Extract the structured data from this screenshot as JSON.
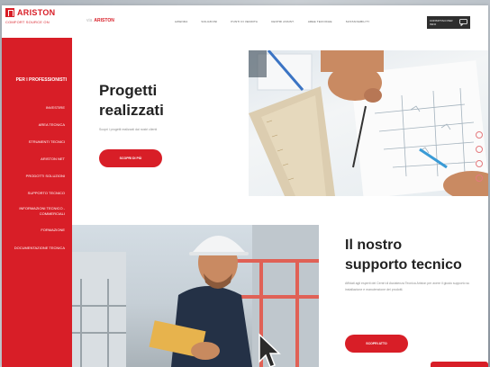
{
  "sidebar": {
    "brand_name": "ARISTON",
    "brand_tagline": "COMFORT SOURCE ON",
    "heading": "PER I PROFESSIONISTI",
    "items": [
      {
        "label": "INVESTIRE"
      },
      {
        "label": "AREA TECNICA"
      },
      {
        "label": "STRUMENTI TECNICI"
      },
      {
        "label": "ARISTON NET"
      },
      {
        "label": "PRODOTTI SOLUZIONI"
      },
      {
        "label": "SUPPORTO TECNICO"
      },
      {
        "label": "INFORMAZIONI TECNICO - COMMERCIALI"
      },
      {
        "label": "FORMAZIONE"
      },
      {
        "label": "DOCUMENTAZIONE TECNICA"
      }
    ]
  },
  "topbar": {
    "logo_prefix": "via",
    "logo_text": "ARISTON",
    "menu": [
      {
        "label": "AZIENDA"
      },
      {
        "label": "SOLUZIONI"
      },
      {
        "label": "PUNTI DI VENDITA"
      },
      {
        "label": "CENTRI ASSIST."
      },
      {
        "label": "AREE TECNICHE"
      },
      {
        "label": "SUSTAINABILITY"
      }
    ],
    "cta_label": "CONTATTACI PER INFO",
    "cta_icon": "chat-icon"
  },
  "hero": {
    "title_line1": "Progetti",
    "title_line2": "realizzati",
    "subtitle": "Scopri i progetti realizzati dai nostri clienti",
    "button_label": "SCOPRI DI PIÙ"
  },
  "support": {
    "title_line1": "Il nostro",
    "title_line2": "supporto tecnico",
    "body": "Affidati agli esperti dei Centri di Assistenza Tecnica Ariston per avere il giusto supporto su installazione e manutenzione dei prodotti.",
    "button_label": "SCOPRI ATTO"
  },
  "floating_icons": [
    "facebook-icon",
    "youtube-icon",
    "instagram-icon",
    "linkedin-icon"
  ],
  "colors": {
    "brand_red": "#d81e27",
    "text_dark": "#222222",
    "cta_dark": "#2e2e2e"
  }
}
